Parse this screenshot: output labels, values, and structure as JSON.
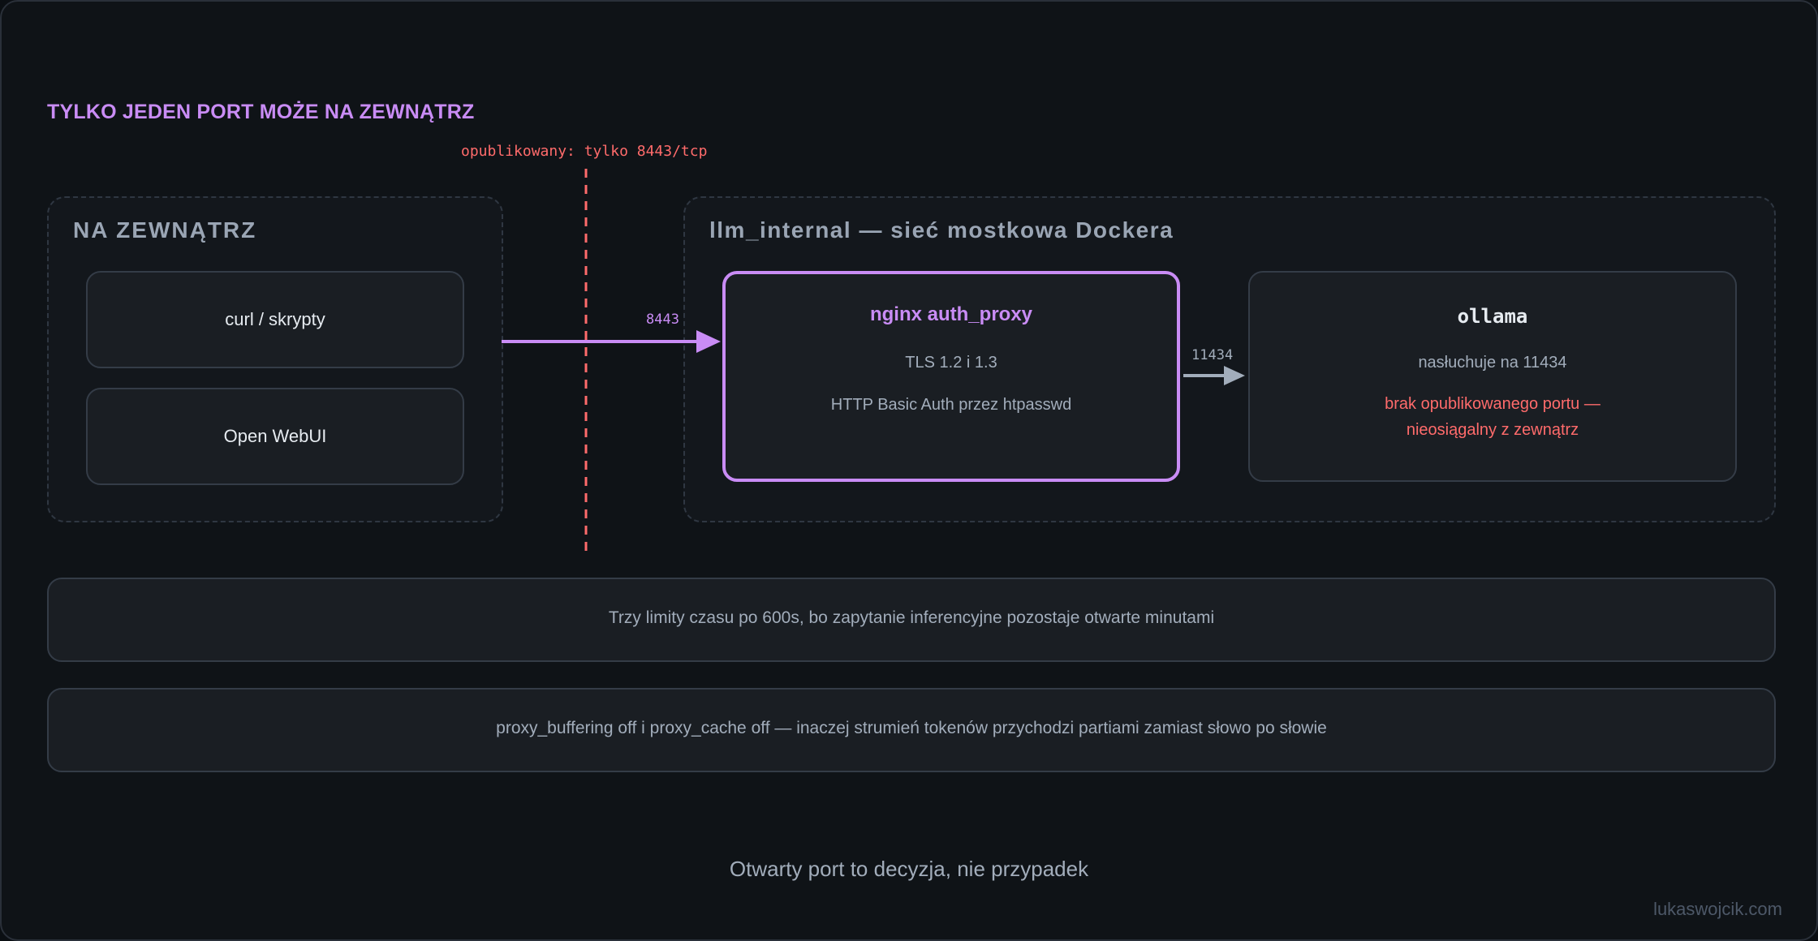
{
  "heading": "TYLKO JEDEN PORT MOŻE NA ZEWNĄTRZ",
  "boundary": {
    "label": "opublikowany: tylko 8443/tcp"
  },
  "outside": {
    "title": "NA ZEWNĄTRZ",
    "clients": [
      "curl / skrypty",
      "Open WebUI"
    ]
  },
  "network": {
    "title": "llm_internal — sieć mostkowa Dockera",
    "proxy": {
      "title": "nginx auth_proxy",
      "lines": [
        "TLS 1.2 i 1.3",
        "HTTP Basic Auth przez htpasswd"
      ]
    },
    "ollama": {
      "title": "ollama",
      "listen": "nasłuchuje na 11434",
      "warning": [
        "brak opublikowanego portu —",
        "nieosiągalny z zewnątrz"
      ]
    }
  },
  "ports": {
    "external": "8443",
    "internal": "11434"
  },
  "notes": [
    "Trzy limity czasu po 600s, bo zapytanie inferencyjne pozostaje otwarte minutami",
    "proxy_buffering off i proxy_cache off — inaczej strumień tokenów przychodzi partiami zamiast słowo po słowie"
  ],
  "footer": "Otwarty port to decyzja, nie przypadek",
  "watermark": "lukaswojcik.com",
  "colors": {
    "accent": "#c98cf5",
    "danger": "#ff6b6b",
    "muted": "#a2adbb"
  }
}
